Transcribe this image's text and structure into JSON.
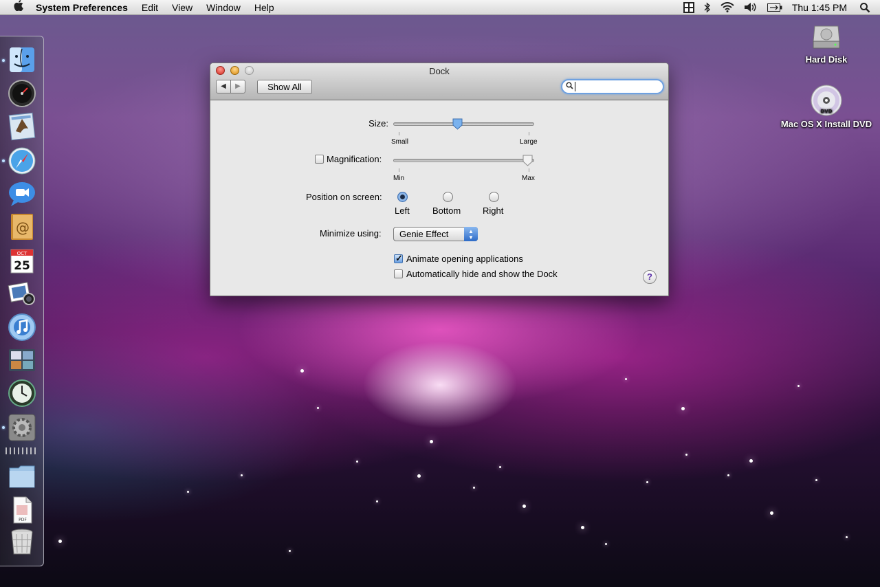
{
  "menubar": {
    "apple_icon": "apple-icon",
    "app_name": "System Preferences",
    "menus": [
      "Edit",
      "View",
      "Window",
      "Help"
    ],
    "status_icons": [
      "spaces-icon",
      "bluetooth-icon",
      "wifi-icon",
      "volume-icon",
      "battery-icon"
    ],
    "clock": "Thu 1:45 PM",
    "spotlight_icon": "spotlight-icon"
  },
  "dock": {
    "items": [
      {
        "name": "finder",
        "running": true
      },
      {
        "name": "dashboard",
        "running": false
      },
      {
        "name": "mail",
        "running": false
      },
      {
        "name": "safari",
        "running": true
      },
      {
        "name": "ichat",
        "running": false
      },
      {
        "name": "address-book",
        "running": false
      },
      {
        "name": "ical",
        "running": false
      },
      {
        "name": "iphoto",
        "running": false
      },
      {
        "name": "itunes",
        "running": false
      },
      {
        "name": "spaces",
        "running": false
      },
      {
        "name": "time-machine",
        "running": false
      },
      {
        "name": "system-preferences",
        "running": true
      },
      {
        "name": "documents-stack",
        "running": false
      },
      {
        "name": "pdf-document",
        "running": false
      },
      {
        "name": "trash",
        "running": false
      }
    ]
  },
  "desktop": {
    "icons": [
      {
        "label": "Hard Disk",
        "icon": "hard-disk-icon"
      },
      {
        "label": "Mac OS X Install DVD",
        "icon": "dvd-icon",
        "badge": "DVD"
      }
    ]
  },
  "window": {
    "title": "Dock",
    "show_all": "Show All",
    "search_value": "",
    "size": {
      "label": "Size:",
      "min_label": "Small",
      "max_label": "Large",
      "value": 0.45
    },
    "magnification": {
      "label": "Magnification:",
      "checked": false,
      "min_label": "Min",
      "max_label": "Max",
      "value": 1.0
    },
    "position": {
      "label": "Position on screen:",
      "options": [
        "Left",
        "Bottom",
        "Right"
      ],
      "selected": "Left"
    },
    "minimize": {
      "label": "Minimize using:",
      "value": "Genie Effect"
    },
    "animate": {
      "label": "Animate opening applications",
      "checked": true
    },
    "autohide": {
      "label": "Automatically hide and show the Dock",
      "checked": false
    },
    "help": "?"
  },
  "colors": {
    "accent": "#4f86d0",
    "close": "#e0443e",
    "minimize": "#e8a33a",
    "zoom_disabled": "#c8c8c8"
  }
}
